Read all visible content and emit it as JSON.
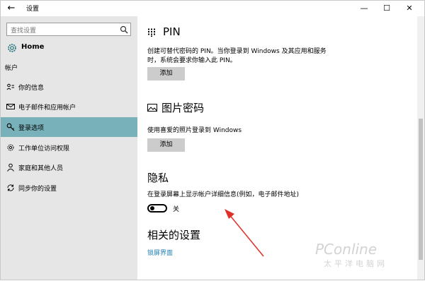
{
  "window": {
    "title": "设置",
    "back_icon": "back-arrow-icon",
    "controls": {
      "minimize": "—",
      "maximize": "☐",
      "close": "✕"
    }
  },
  "sidebar": {
    "search": {
      "placeholder": "查找设置",
      "icon": "search-icon"
    },
    "home": {
      "label": "Home",
      "icon": "gear-icon"
    },
    "section_label": "帐户",
    "items": [
      {
        "label": "你的信息",
        "icon": "person-card-icon",
        "active": false
      },
      {
        "label": "电子邮件和应用帐户",
        "icon": "mail-icon",
        "active": false
      },
      {
        "label": "登录选项",
        "icon": "key-icon",
        "active": true
      },
      {
        "label": "工作单位访问权限",
        "icon": "briefcase-icon",
        "active": false
      },
      {
        "label": "家庭和其他人员",
        "icon": "person-icon",
        "active": false
      },
      {
        "label": "同步你的设置",
        "icon": "sync-icon",
        "active": false
      }
    ]
  },
  "main": {
    "pin": {
      "title": "PIN",
      "desc_line1": "创建可替代密码的 PIN。当你登录到 Windows 及其应用和服务",
      "desc_line2": "时，系统会要求你输入此 PIN。",
      "button": "添加"
    },
    "picture_password": {
      "title": "图片密码",
      "desc": "使用喜爱的照片登录到 Windows",
      "button": "添加"
    },
    "privacy": {
      "title": "隐私",
      "desc": "在登录屏幕上显示帐户详细信息(例如，电子邮件地址)",
      "toggle_state": "关",
      "toggle_on": false
    },
    "related": {
      "title": "相关的设置",
      "link": "锁屏界面"
    }
  },
  "watermark": {
    "main": "PConline",
    "sub": "太平洋电脑网"
  },
  "colors": {
    "sidebar_bg": "#e6e6e6",
    "active_item_bg": "#78b1b9",
    "button_bg": "#cccccc",
    "link": "#1f7fb3",
    "annotation_arrow": "#e0302a"
  }
}
